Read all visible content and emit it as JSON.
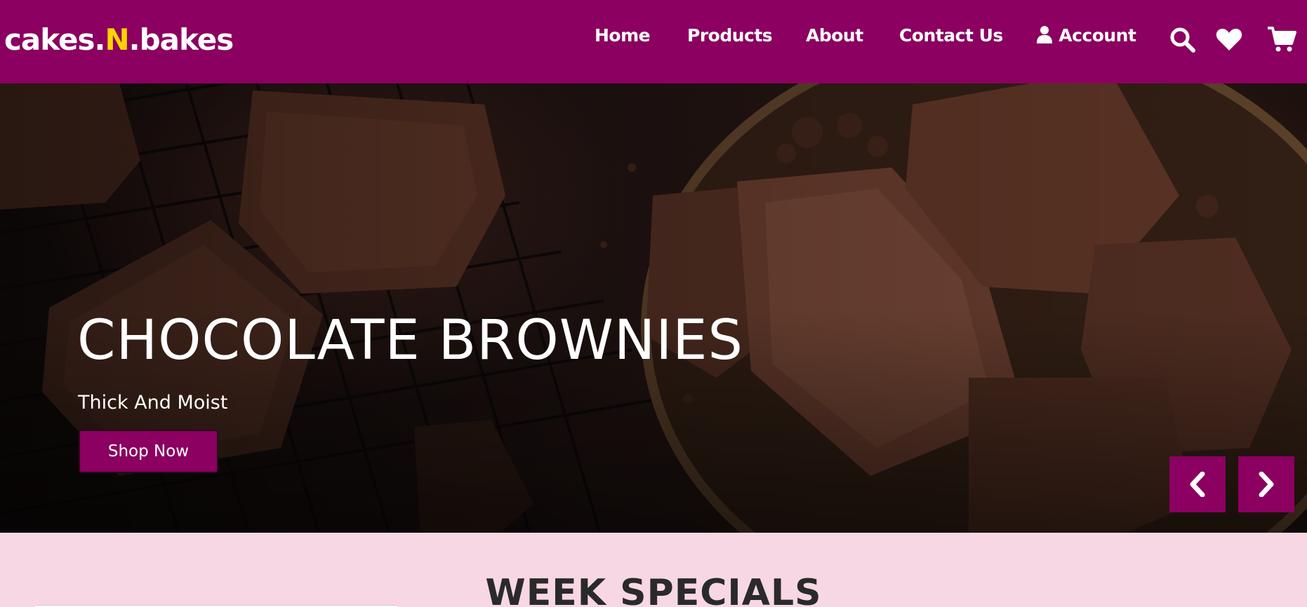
{
  "brand": {
    "part1": "cakes.",
    "part2": "N",
    "part3": ".bakes"
  },
  "nav": {
    "home": "Home",
    "products": "Products",
    "about": "About",
    "contact": "Contact Us",
    "account": "Account"
  },
  "icons": {
    "account": "user-icon",
    "search": "search-icon",
    "wishlist": "heart-icon",
    "cart": "cart-icon",
    "prev": "chevron-left-icon",
    "next": "chevron-right-icon"
  },
  "hero": {
    "title": "CHOCOLATE BROWNIES",
    "subtitle": "Thick And Moist",
    "cta": "Shop Now"
  },
  "specials": {
    "title": "WEEK SPECIALS"
  },
  "colors": {
    "brand": "#8b0060",
    "accent": "#ffd400",
    "section_bg": "#f8d7e5"
  }
}
